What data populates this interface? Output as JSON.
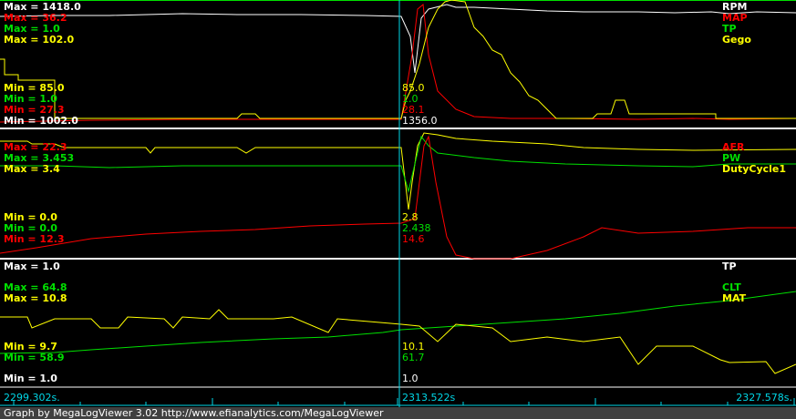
{
  "panels": [
    {
      "max": [
        "Max = 1418.0",
        "Max = 36.2",
        "Max = 1.0",
        "Max = 102.0"
      ],
      "min": [
        "Min = 85.0",
        "Min = 1.0",
        "Min = 27.3",
        "Min = 1002.0"
      ],
      "names": [
        "RPM",
        "MAP",
        "TP",
        "Gego"
      ],
      "cursor": [
        "85.0",
        "1.0",
        "28.1",
        "1356.0"
      ]
    },
    {
      "max": [
        "Max = 22.3",
        "Max = 3.453",
        "Max = 3.4"
      ],
      "min": [
        "Min = 0.0",
        "Min = 0.0",
        "Min = 12.3"
      ],
      "names": [
        "AFR",
        "PW",
        "DutyCycle1"
      ],
      "cursor": [
        "2.8",
        "2.438",
        "14.6"
      ]
    },
    {
      "max": [
        "Max = 1.0",
        "Max = 64.8",
        "Max = 10.8"
      ],
      "min": [
        "Min = 9.7",
        "Min = 58.9",
        "Min = 1.0"
      ],
      "names": [
        "TP",
        "CLT",
        "MAT"
      ],
      "cursor": [
        "10.1",
        "61.7",
        "1.0"
      ]
    }
  ],
  "timeline": {
    "start": "2299.302s.",
    "cursor": "2313.522s",
    "end": "2327.578s."
  },
  "footer": "Graph by MegaLogViewer 3.02 http://www.efianalytics.com/MegaLogViewer",
  "colors": {
    "white": "#ffffff",
    "red": "#ff0000",
    "green": "#00e000",
    "yellow": "#ffff00",
    "cyan": "#00d8e8"
  }
}
